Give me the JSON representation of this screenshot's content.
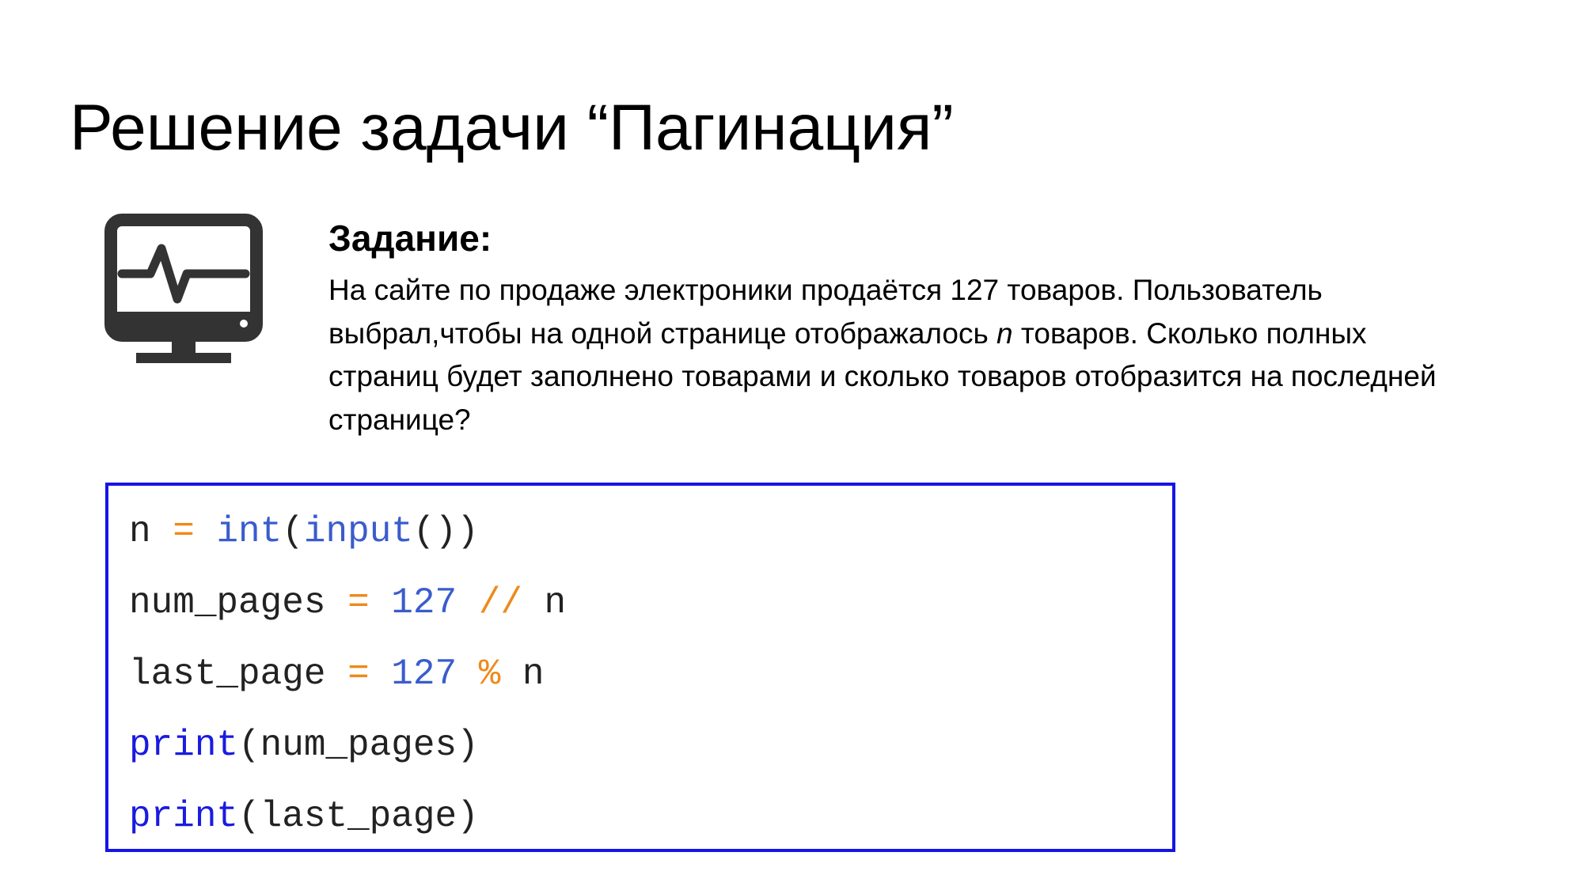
{
  "slide": {
    "title": "Решение задачи “Пагинация”",
    "icon": "monitor-heartbeat-icon",
    "task": {
      "heading": "Задание:",
      "text_part1": "На сайте по продаже электроники продаётся 127 товаров. Пользователь выбрал,чтобы на одной странице отображалось ",
      "text_var": "n",
      "text_part2": " товаров. Сколько полных страниц будет заполнено товарами и сколько товаров отобразится на последней странице?"
    },
    "code": {
      "border_color": "#1515e6",
      "colors": {
        "operator": "#ee8a1a",
        "builtin": "#3a5ccd",
        "number": "#3a5ccd",
        "keyword": "#1a1ae0",
        "text": "#222222"
      },
      "lines": [
        {
          "tokens": [
            {
              "text": "n",
              "type": "plain"
            },
            {
              "text": " ",
              "type": "plain"
            },
            {
              "text": "=",
              "type": "op"
            },
            {
              "text": " ",
              "type": "plain"
            },
            {
              "text": "int",
              "type": "bi"
            },
            {
              "text": "(",
              "type": "plain"
            },
            {
              "text": "input",
              "type": "bi"
            },
            {
              "text": "())",
              "type": "plain"
            }
          ]
        },
        {
          "tokens": [
            {
              "text": "num_pages",
              "type": "plain"
            },
            {
              "text": " ",
              "type": "plain"
            },
            {
              "text": "=",
              "type": "op"
            },
            {
              "text": " ",
              "type": "plain"
            },
            {
              "text": "127",
              "type": "num"
            },
            {
              "text": " ",
              "type": "plain"
            },
            {
              "text": "//",
              "type": "op"
            },
            {
              "text": " n",
              "type": "plain"
            }
          ]
        },
        {
          "tokens": [
            {
              "text": "last_page",
              "type": "plain"
            },
            {
              "text": " ",
              "type": "plain"
            },
            {
              "text": "=",
              "type": "op"
            },
            {
              "text": " ",
              "type": "plain"
            },
            {
              "text": "127",
              "type": "num"
            },
            {
              "text": " ",
              "type": "plain"
            },
            {
              "text": "%",
              "type": "op"
            },
            {
              "text": " n",
              "type": "plain"
            }
          ]
        },
        {
          "tokens": [
            {
              "text": "print",
              "type": "kw"
            },
            {
              "text": "(num_pages)",
              "type": "plain"
            }
          ]
        },
        {
          "tokens": [
            {
              "text": "print",
              "type": "kw"
            },
            {
              "text": "(last_page)",
              "type": "plain"
            }
          ]
        }
      ]
    }
  }
}
